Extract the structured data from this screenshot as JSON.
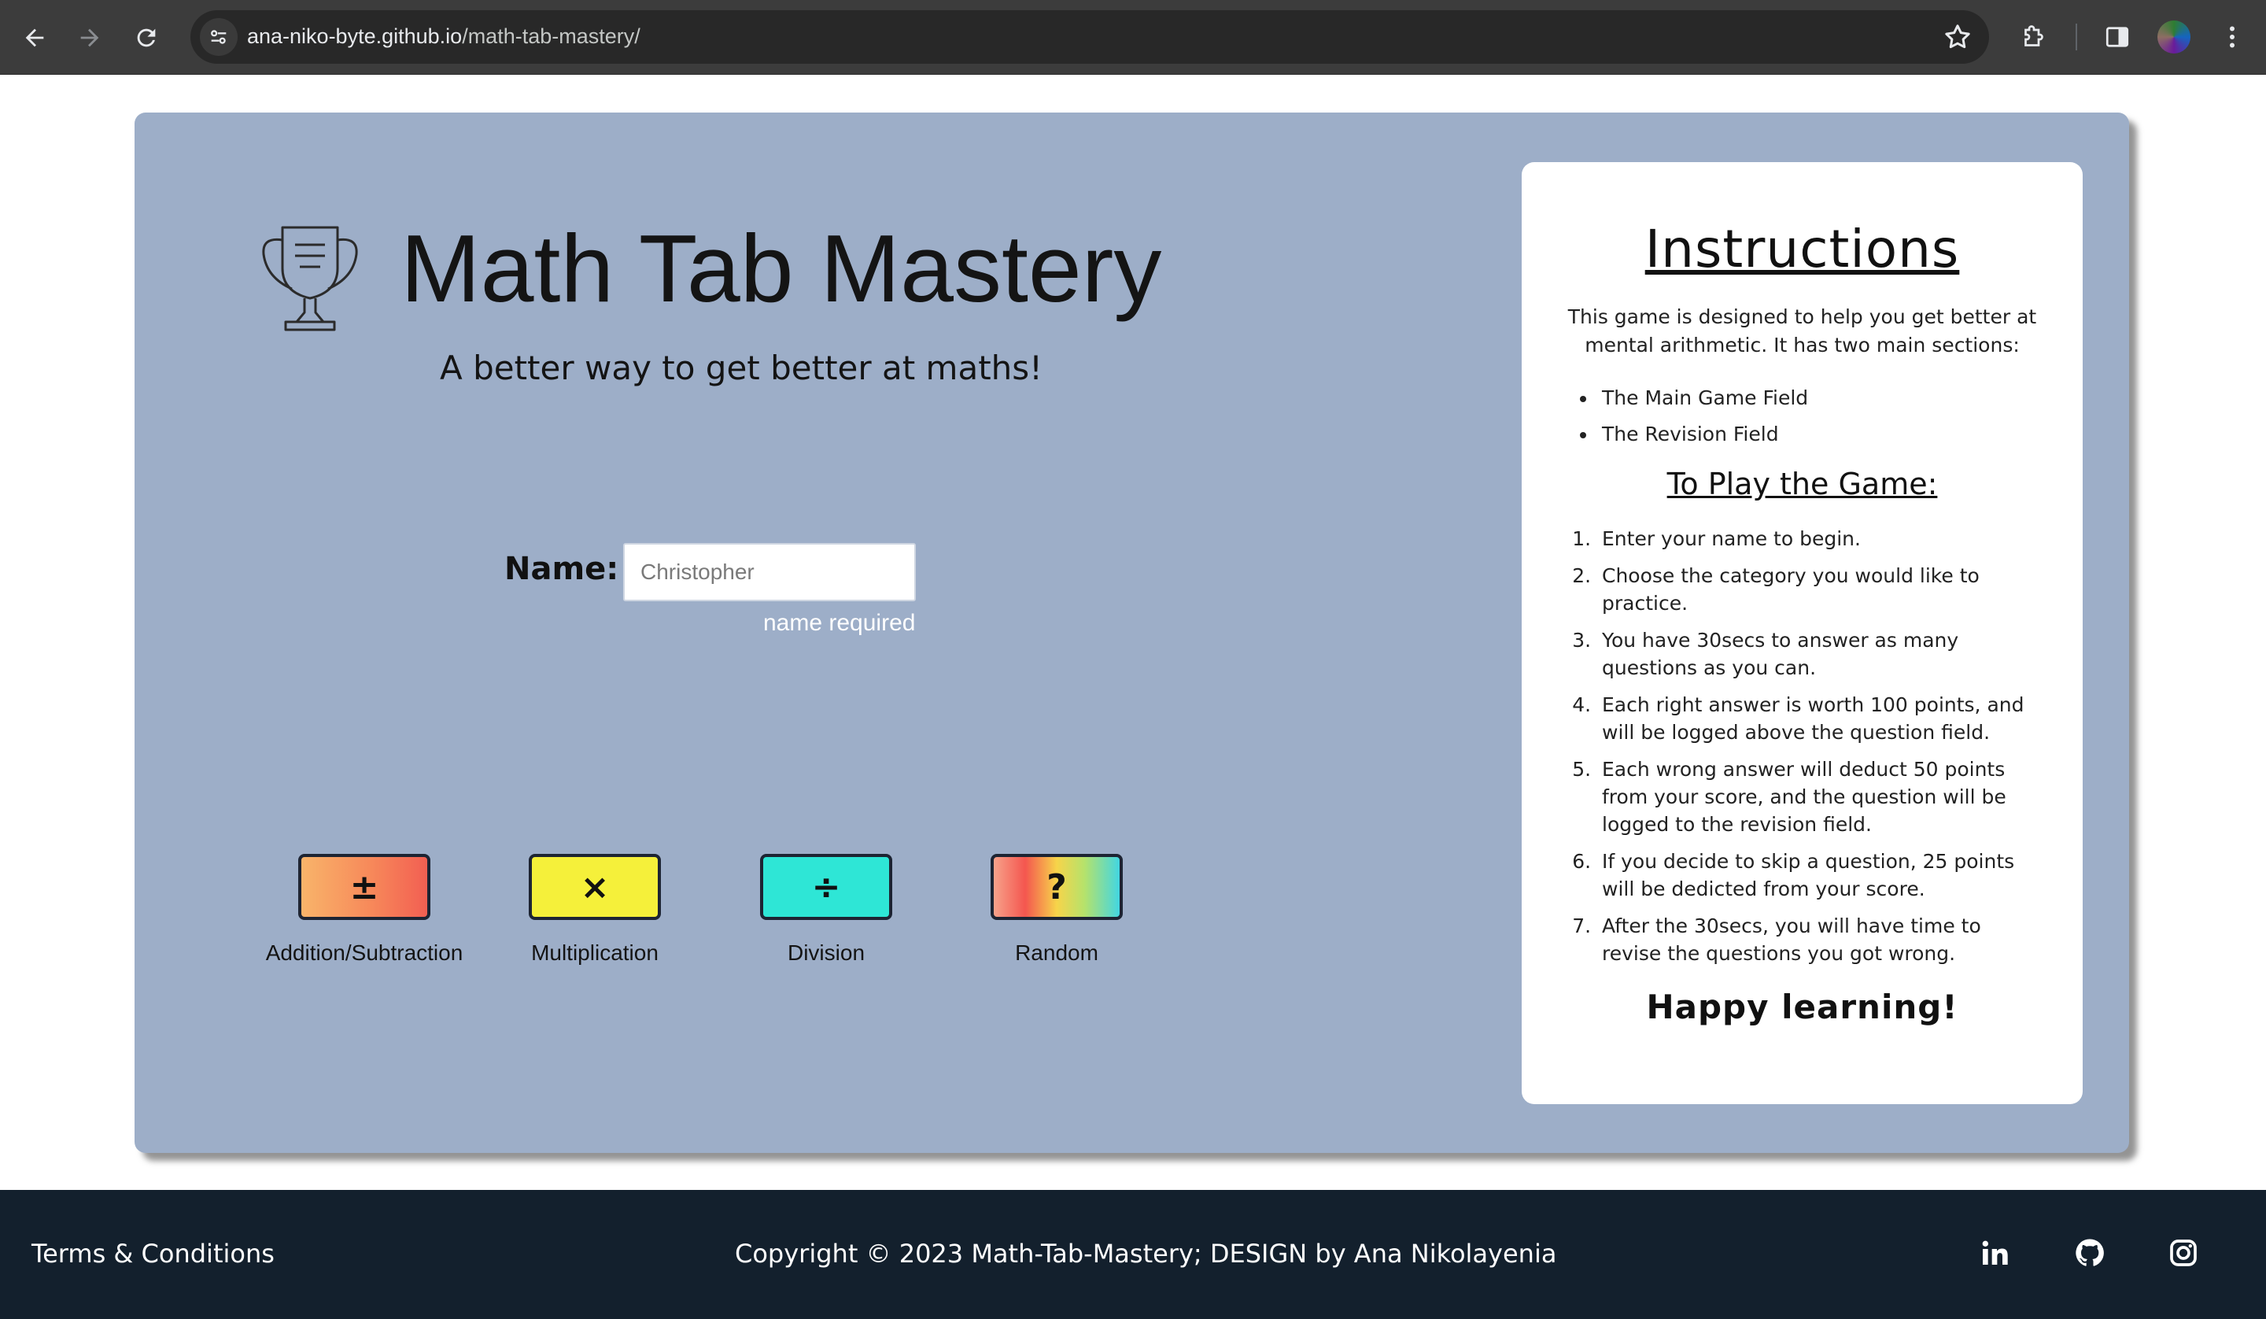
{
  "browser": {
    "url_host": "ana-niko-byte.github.io",
    "url_path": "/math-tab-mastery/",
    "back_icon": "arrow-left-icon",
    "forward_icon": "arrow-right-icon",
    "reload_icon": "reload-icon",
    "site_info_icon": "tune-icon",
    "bookmark_icon": "star-icon",
    "extensions_icon": "puzzle-icon",
    "sidepanel_icon": "side-panel-icon",
    "menu_icon": "kebab-menu-icon"
  },
  "hero": {
    "title": "Math Tab Mastery",
    "tagline": "A better way to get better at maths!",
    "logo_icon": "trophy-icon"
  },
  "name_form": {
    "label": "Name:",
    "placeholder": "Christopher",
    "value": "",
    "validation": "name required"
  },
  "categories": [
    {
      "symbol": "±",
      "label": "Addition/Subtraction",
      "color": "#f79a5e"
    },
    {
      "symbol": "×",
      "label": "Multiplication",
      "color": "#f5f03a"
    },
    {
      "symbol": "÷",
      "label": "Division",
      "color": "#2ee6d6"
    },
    {
      "symbol": "?",
      "label": "Random",
      "color": "rainbow"
    }
  ],
  "instructions": {
    "title": "Instructions",
    "intro": "This game is designed to help you get better at mental arithmetic. It has two main sections:",
    "sections": [
      "The Main Game Field",
      "The Revision Field"
    ],
    "subtitle": "To Play the Game:",
    "steps": [
      "Enter your name to begin.",
      "Choose the category you would like to practice.",
      "You have 30secs to answer as many questions as you can.",
      "Each right answer is worth 100 points, and will be logged above the question field.",
      "Each wrong answer will deduct 50 points from your score, and the question will be logged to the revision field.",
      "If you decide to skip a question, 25 points will be dedicted from your score.",
      "After the 30secs, you will have time to revise the questions you got wrong."
    ],
    "closing": "Happy learning!"
  },
  "footer": {
    "terms": "Terms & Conditions",
    "copyright": "Copyright © 2023 Math-Tab-Mastery; DESIGN by Ana Nikolayenia",
    "social": [
      "linkedin-icon",
      "github-icon",
      "instagram-icon"
    ]
  },
  "colors": {
    "card_bg": "#9daec8",
    "footer_bg": "#13202d",
    "chrome_bg": "#3c3c3c"
  }
}
